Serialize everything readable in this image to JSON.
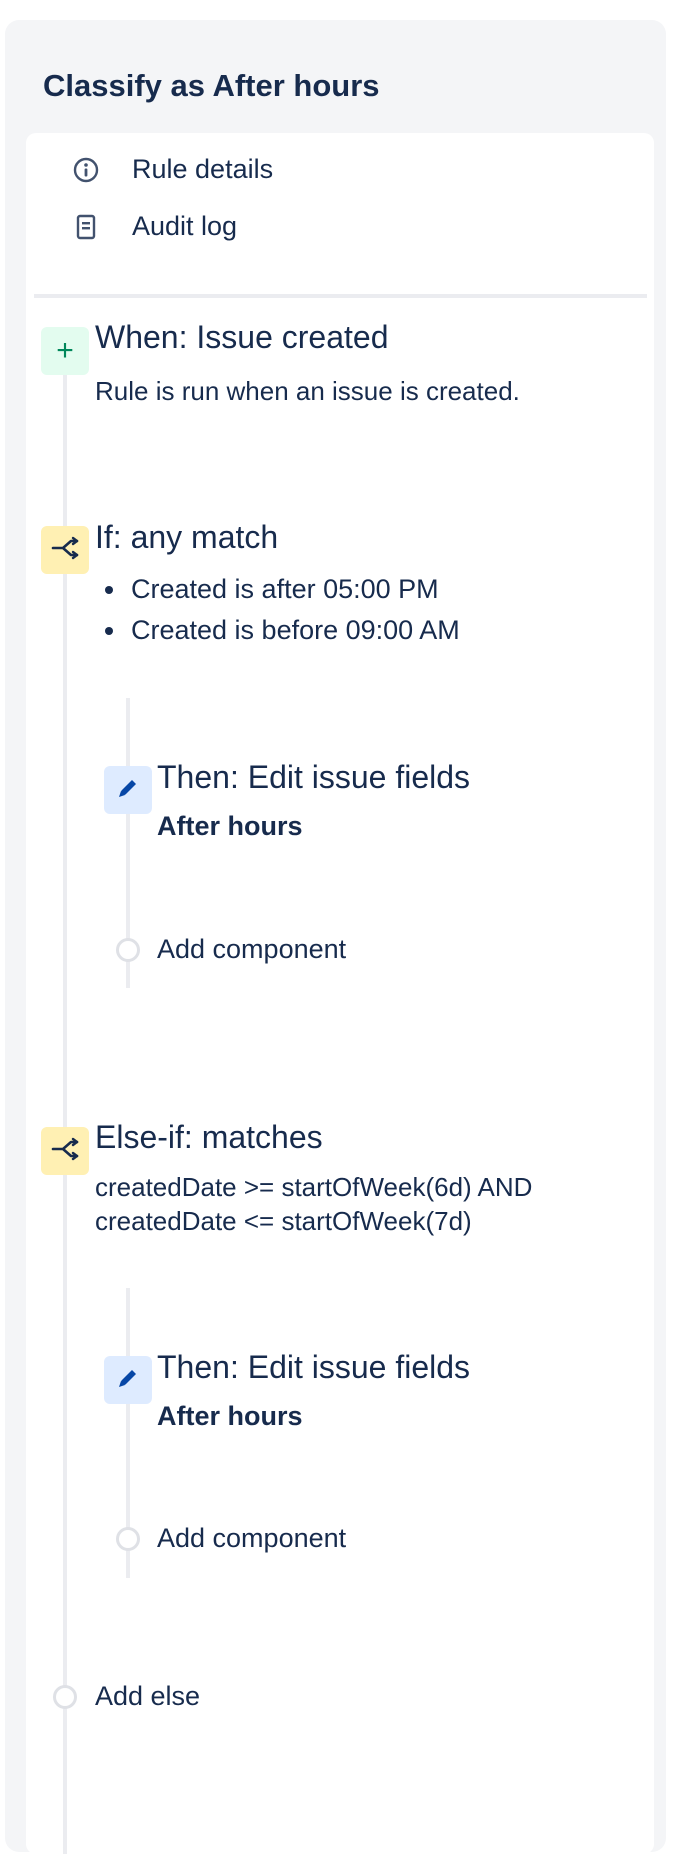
{
  "panel": {
    "title": "Classify as After hours"
  },
  "menu": {
    "rule_details": "Rule details",
    "audit_log": "Audit log"
  },
  "trigger": {
    "title": "When: Issue created",
    "description": "Rule is run when an issue is created.",
    "icon": "plus-icon"
  },
  "if_block": {
    "title": "If: any match",
    "icon": "branch-icon",
    "conditions": [
      "Created is after 05:00 PM",
      "Created is before 09:00 AM"
    ],
    "action": {
      "title": "Then: Edit issue fields",
      "detail": "After hours",
      "icon": "pencil-icon"
    },
    "add_component": "Add component"
  },
  "else_if_block": {
    "title": "Else-if: matches",
    "icon": "branch-icon",
    "jql_lines": [
      "createdDate >= startOfWeek(6d) AND",
      "createdDate <= startOfWeek(7d)"
    ],
    "action": {
      "title": "Then: Edit issue fields",
      "detail": "After hours",
      "icon": "pencil-icon"
    },
    "add_component": "Add component"
  },
  "add_else": "Add else",
  "colors": {
    "text": "#172b4d",
    "panel_bg": "#f4f5f7",
    "green_badge": "#e3fcef",
    "yellow_badge": "#fff0b3",
    "blue_badge": "#deebff",
    "timeline": "#ebecf0"
  }
}
